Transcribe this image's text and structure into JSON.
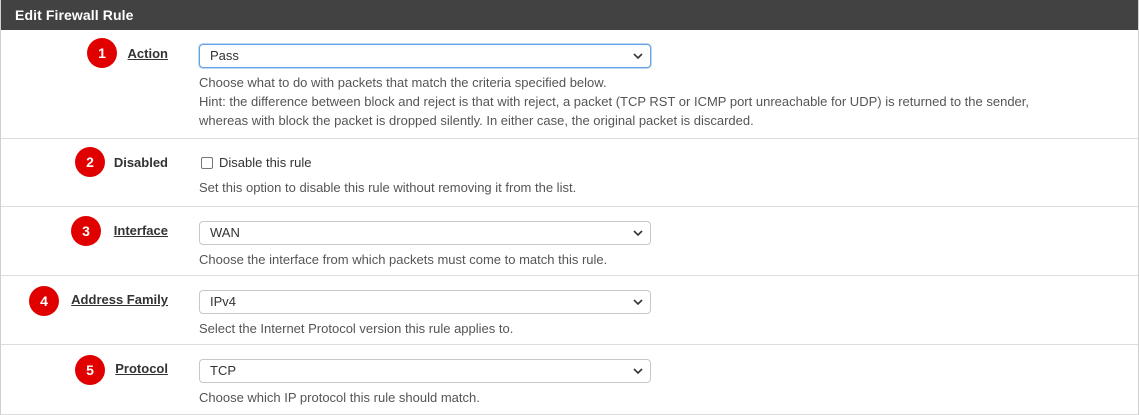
{
  "panel": {
    "title": "Edit Firewall Rule"
  },
  "rows": [
    {
      "badge": "1",
      "label": "Action",
      "select_value": "Pass",
      "help": [
        "Choose what to do with packets that match the criteria specified below.",
        "Hint: the difference between block and reject is that with reject, a packet (TCP RST or ICMP port unreachable for UDP) is returned to the sender,",
        "whereas with block the packet is dropped silently. In either case, the original packet is discarded."
      ]
    },
    {
      "badge": "2",
      "label": "Disabled",
      "checkbox_label": "Disable this rule",
      "checked": false,
      "help": [
        "Set this option to disable this rule without removing it from the list."
      ]
    },
    {
      "badge": "3",
      "label": "Interface",
      "select_value": "WAN",
      "help": [
        "Choose the interface from which packets must come to match this rule."
      ]
    },
    {
      "badge": "4",
      "label": "Address Family",
      "select_value": "IPv4",
      "help": [
        "Select the Internet Protocol version this rule applies to."
      ]
    },
    {
      "badge": "5",
      "label": "Protocol",
      "select_value": "TCP",
      "help": [
        "Choose which IP protocol this rule should match."
      ]
    }
  ],
  "colors": {
    "header_bg": "#424242",
    "badge_red": "#e00000",
    "focus_blue": "#66a3e0"
  },
  "icons": {
    "select_chevron": "chevron-down-icon"
  }
}
